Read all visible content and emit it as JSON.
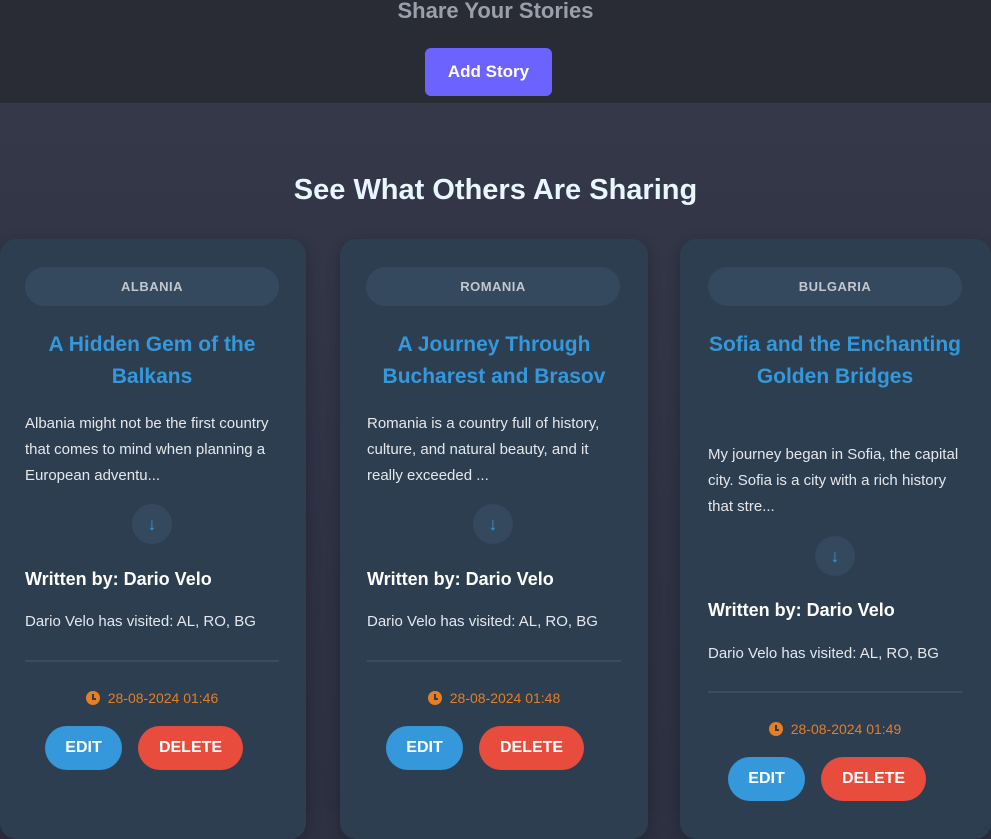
{
  "header": {
    "section_title": "Share Your Stories",
    "add_story_label": "Add Story"
  },
  "gallery": {
    "title": "See What Others Are Sharing"
  },
  "cards": [
    {
      "country": "ALBANIA",
      "title": "A Hidden Gem of the Balkans",
      "excerpt": "Albania might not be the first country that comes to mind when planning a European adventu...",
      "expand_icon": "↓",
      "author": "Written by: Dario Velo",
      "visited": "Dario Velo has visited: AL, RO, BG",
      "timestamp": "28-08-2024 01:46",
      "edit_label": "EDIT",
      "delete_label": "DELETE"
    },
    {
      "country": "ROMANIA",
      "title": "A Journey Through Bucharest and Brasov",
      "excerpt": "Romania is a country full of history, culture, and natural beauty, and it really exceeded ...",
      "expand_icon": "↓",
      "author": "Written by: Dario Velo",
      "visited": "Dario Velo has visited: AL, RO, BG",
      "timestamp": "28-08-2024 01:48",
      "edit_label": "EDIT",
      "delete_label": "DELETE"
    },
    {
      "country": "BULGARIA",
      "title": "Sofia and the Enchanting Golden Bridges",
      "excerpt": "My journey began in Sofia, the capital city. Sofia is a city with a rich history that stre...",
      "expand_icon": "↓",
      "author": "Written by: Dario Velo",
      "visited": "Dario Velo has visited: AL, RO, BG",
      "timestamp": "28-08-2024 01:49",
      "edit_label": "EDIT",
      "delete_label": "DELETE"
    }
  ],
  "colors": {
    "accent": "#6c63ff",
    "title_blue": "#3498db",
    "delete_red": "#e74c3c",
    "timestamp_orange": "#e67e22",
    "card_bg": "#2c3e50"
  }
}
